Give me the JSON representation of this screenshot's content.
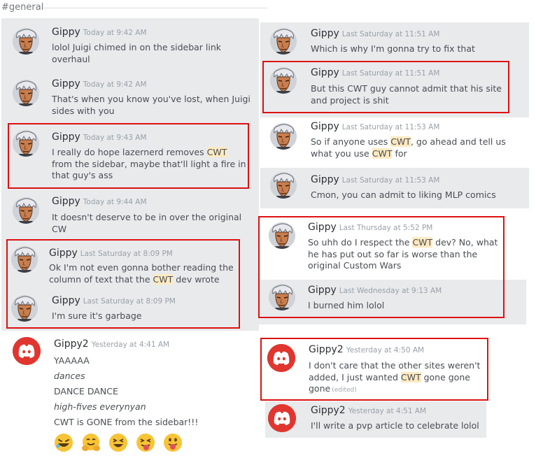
{
  "channel": "#general",
  "avatar_icon": "gippy-avatar-icon",
  "discord_icon": "discord-logo-icon",
  "colors": {
    "highlight": "#fdeac1",
    "redbox": "#dd1111",
    "panel_gray": "#e9eaec"
  },
  "left": [
    {
      "user": "Gippy",
      "time": "Today at 9:42 AM",
      "lines": [
        "lolol Juigi chimed in on the sidebar link",
        "overhaul"
      ]
    },
    {
      "user": "Gippy",
      "time": "Today at 9:42 AM",
      "lines": [
        "That's when you know you've lost, when Juigi",
        "sides with you"
      ]
    },
    {
      "user": "Gippy",
      "time": "Today at 9:43 AM",
      "line1_pre": "I really do hope lazernerd removes ",
      "hl": "CWT",
      "line2": "from the sidebar, maybe that'll light a fire in",
      "line3": "that guy's ass"
    },
    {
      "user": "Gippy",
      "time": "Today at 9:44 AM",
      "lines": [
        "It doesn't deserve to be in over the original",
        "CW"
      ]
    },
    {
      "user": "Gippy",
      "time": "Last Saturday at 8:09 PM",
      "line1": "Ok I'm not even gonna bother reading the",
      "line2_pre": "column of text that the ",
      "hl": "CWT",
      "line2_post": " dev wrote"
    },
    {
      "user": "Gippy",
      "time": "Last Saturday at 8:09 PM",
      "lines": [
        "I'm sure it's garbage"
      ]
    },
    {
      "user": "Gippy2",
      "time": "Yesterday at 4:41 AM",
      "lines": [
        "YAAAAA",
        "dances",
        "DANCE DANCE",
        "high-fives everynyan",
        "CWT is GONE from the sidebar!!!"
      ],
      "emojis": [
        "rofl-emoji-icon",
        "hugging-emoji-icon",
        "laughing-emoji-icon",
        "squinting-tongue-emoji-icon",
        "tongue-emoji-icon"
      ]
    }
  ],
  "right": [
    {
      "user": "Gippy",
      "time": "Last Saturday at 11:51 AM",
      "lines": [
        "Which is why I'm gonna try to fix that"
      ]
    },
    {
      "user": "Gippy",
      "time": "Last Saturday at 11:51 AM",
      "lines": [
        "But this CWT guy cannot admit that his site",
        "and project is shit"
      ]
    },
    {
      "user": "Gippy",
      "time": "Last Saturday at 11:53 AM",
      "l1a": "So if anyone uses ",
      "hl": "CWT",
      "l1b": ", go ahead and tell us",
      "l2a": "what you use ",
      "l2b": " for"
    },
    {
      "user": "Gippy",
      "time": "Last Saturday at 11:53 AM",
      "lines": [
        "Cmon, you can admit to liking MLP comics"
      ]
    },
    {
      "user": "Gippy",
      "time": "Last Thursday at 5:52 PM",
      "l1a": "So uhh do I respect the ",
      "hl": "CWT",
      "l1b": " dev? No, what",
      "l2": "he has put out so far is worse than the",
      "l3": "original Custom Wars"
    },
    {
      "user": "Gippy",
      "time": "Last Wednesday at 9:13 AM",
      "lines": [
        "I burned him lolol"
      ]
    },
    {
      "user": "Gippy2",
      "time": "Yesterday at 4:50 AM",
      "l1": "I don't care that the other sites weren't",
      "l2a": "added, I just wanted ",
      "hl": "CWT",
      "l2b": " gone gone",
      "l3": "gone",
      "edited": "(edited)"
    },
    {
      "user": "Gippy2",
      "time": "Yesterday at 4:51 AM",
      "lines": [
        "I'll write a pvp article to celebrate lolol"
      ]
    }
  ]
}
